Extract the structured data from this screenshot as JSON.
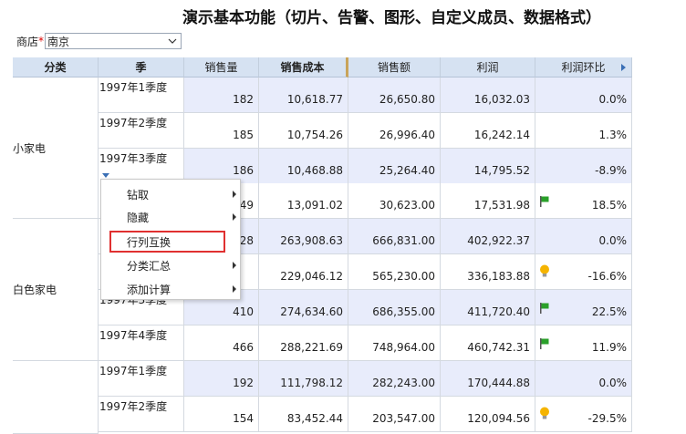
{
  "title": "演示基本功能（切片、告警、图形、自定义成员、数据格式）",
  "filter": {
    "label": "商店",
    "required_mark": "*",
    "value": "南京"
  },
  "columns": [
    "分类",
    "季",
    "销售量",
    "销售成本",
    "销售额",
    "利润",
    "利润环比"
  ],
  "categories": [
    "小家电",
    "白色家电"
  ],
  "rows": [
    {
      "quarter": "1997年1季度",
      "qty": "182",
      "cost": "10,618.77",
      "sales": "26,650.80",
      "profit": "16,032.03",
      "ratio": "0.0%",
      "icon": ""
    },
    {
      "quarter": "1997年2季度",
      "qty": "185",
      "cost": "10,754.26",
      "sales": "26,996.40",
      "profit": "16,242.14",
      "ratio": "1.3%",
      "icon": ""
    },
    {
      "quarter": "1997年3季度",
      "qty": "186",
      "cost": "10,468.88",
      "sales": "25,264.40",
      "profit": "14,795.52",
      "ratio": "-8.9%",
      "icon": ""
    },
    {
      "quarter": "",
      "qty": "49",
      "cost": "13,091.02",
      "sales": "30,623.00",
      "profit": "17,531.98",
      "ratio": "18.5%",
      "icon": "flag-icon"
    },
    {
      "quarter": "",
      "qty": "28",
      "cost": "263,908.63",
      "sales": "666,831.00",
      "profit": "402,922.37",
      "ratio": "0.0%",
      "icon": ""
    },
    {
      "quarter": "",
      "qty": "",
      "cost": "229,046.12",
      "sales": "565,230.00",
      "profit": "336,183.88",
      "ratio": "-16.6%",
      "icon": "bulb-icon"
    },
    {
      "quarter": "1997年3季度",
      "qty": "410",
      "cost": "274,634.60",
      "sales": "686,355.00",
      "profit": "411,720.40",
      "ratio": "22.5%",
      "icon": "flag-icon"
    },
    {
      "quarter": "1997年4季度",
      "qty": "466",
      "cost": "288,221.69",
      "sales": "748,964.00",
      "profit": "460,742.31",
      "ratio": "11.9%",
      "icon": "flag-icon"
    },
    {
      "quarter": "1997年1季度",
      "qty": "192",
      "cost": "111,798.12",
      "sales": "282,243.00",
      "profit": "170,444.88",
      "ratio": "0.0%",
      "icon": ""
    },
    {
      "quarter": "1997年2季度",
      "qty": "154",
      "cost": "83,452.44",
      "sales": "203,547.00",
      "profit": "120,094.56",
      "ratio": "-29.5%",
      "icon": "bulb-icon"
    }
  ],
  "context_menu": [
    {
      "label": "钻取",
      "has_submenu": true
    },
    {
      "label": "隐藏",
      "has_submenu": true
    },
    {
      "label": "行列互换",
      "has_submenu": false
    },
    {
      "label": "分类汇总",
      "has_submenu": true
    },
    {
      "label": "添加计算",
      "has_submenu": true
    }
  ],
  "colors": {
    "header_bg": "#d6e2f2",
    "band_bg": "#e8ecfb",
    "flag": "#2aa02a",
    "bulb": "#f5b400",
    "highlight": "#e03030"
  }
}
